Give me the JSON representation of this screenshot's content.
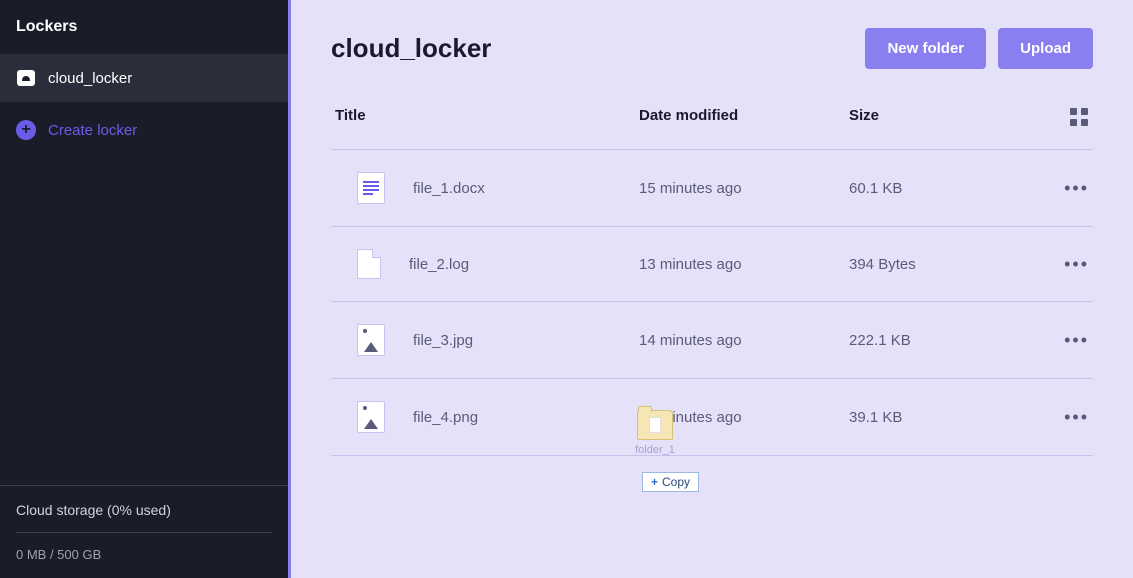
{
  "sidebar": {
    "title": "Lockers",
    "lockers": [
      {
        "name": "cloud_locker"
      }
    ],
    "create_label": "Create locker",
    "storage": {
      "label": "Cloud storage (0% used)",
      "usage_text": "0 MB / 500 GB"
    }
  },
  "main": {
    "title": "cloud_locker",
    "actions": {
      "new_folder": "New folder",
      "upload": "Upload"
    },
    "columns": {
      "title": "Title",
      "date": "Date modified",
      "size": "Size"
    },
    "files": [
      {
        "name": "file_1.docx",
        "date": "15 minutes ago",
        "size": "60.1 KB",
        "icon": "doc"
      },
      {
        "name": "file_2.log",
        "date": "13 minutes ago",
        "size": "394 Bytes",
        "icon": "blank"
      },
      {
        "name": "file_3.jpg",
        "date": "14 minutes ago",
        "size": "222.1 KB",
        "icon": "image"
      },
      {
        "name": "file_4.png",
        "date": "17 minutes ago",
        "size": "39.1 KB",
        "icon": "image"
      }
    ]
  },
  "drag": {
    "folder_label": "folder_1",
    "tooltip": "Copy"
  }
}
